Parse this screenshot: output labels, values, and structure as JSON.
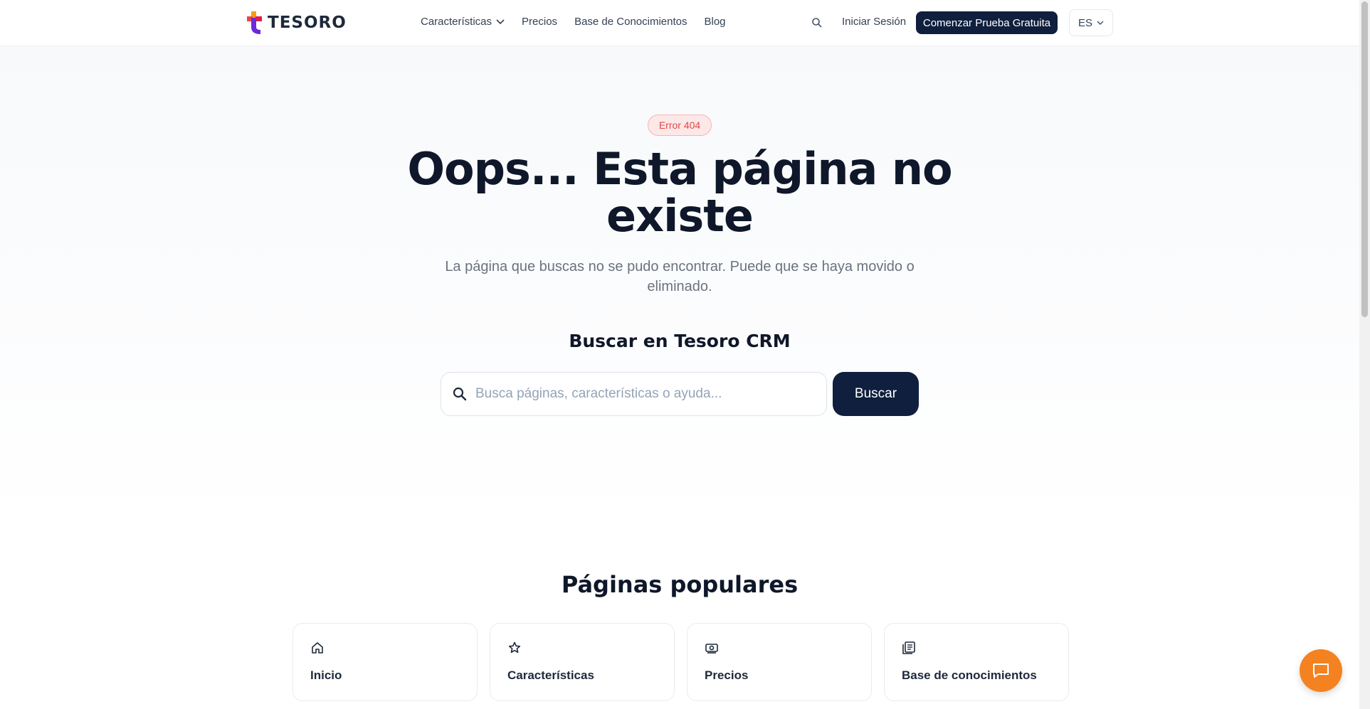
{
  "nav": {
    "logo_text": "TESORO",
    "links": [
      {
        "label": "Características"
      },
      {
        "label": "Precios"
      },
      {
        "label": "Base de Conocimientos"
      },
      {
        "label": "Blog"
      }
    ],
    "login_label": "Iniciar Sesión",
    "cta_label": "Comenzar Prueba Gratuita",
    "lang_label": "ES"
  },
  "hero": {
    "badge": "Error 404",
    "title": "Oops... Esta página no existe",
    "subtitle": "La página que buscas no se pudo encontrar. Puede que se haya movido o eliminado.",
    "search_title": "Buscar en Tesoro CRM",
    "search_placeholder": "Busca páginas, características o ayuda...",
    "search_button": "Buscar"
  },
  "popular": {
    "title": "Páginas populares",
    "cards": [
      {
        "label": "Inicio",
        "icon": "home-icon"
      },
      {
        "label": "Características",
        "icon": "star-icon"
      },
      {
        "label": "Precios",
        "icon": "money-icon"
      },
      {
        "label": "Base de conocimientos",
        "icon": "document-icon"
      }
    ]
  },
  "colors": {
    "primary": "#0f1f3d",
    "badge_text": "#e0494a",
    "chat": "#f58220"
  }
}
